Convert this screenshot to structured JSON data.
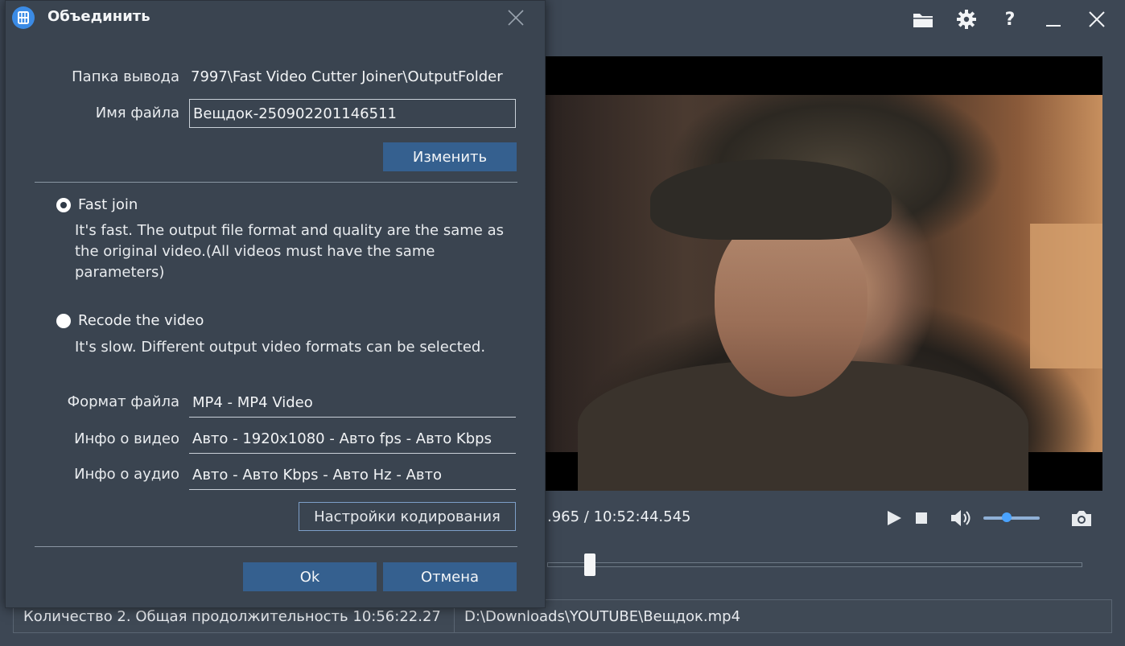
{
  "dialog": {
    "title": "Объединить",
    "output_folder_label": "Папка вывода",
    "output_folder_value": "7997\\Fast Video Cutter Joiner\\OutputFolder",
    "file_name_label": "Имя файла",
    "file_name_value": "Вещдок-250902201146511",
    "change_button": "Изменить",
    "fast_join_label": "Fast join",
    "fast_join_desc": "It's fast. The output file format and quality are the same as the original video.(All videos must have the same parameters)",
    "fast_join_selected": true,
    "recode_label": "Recode the video",
    "recode_desc": "It's slow. Different output video formats can be selected.",
    "recode_selected": false,
    "file_format_label": "Формат файла",
    "file_format_value": "MP4 - MP4 Video",
    "video_info_label": "Инфо о видео",
    "video_info_value": "Авто - 1920x1080 - Авто fps - Авто Kbps",
    "audio_info_label": "Инфо о аудио",
    "audio_info_value": "Авто - Авто Kbps - Авто Hz - Авто",
    "encoding_settings_button": "Настройки кодирования",
    "ok_button": "Ok",
    "cancel_button": "Отмена"
  },
  "player": {
    "time_readout": ".965 / 10:52:44.545",
    "volume_level": 0.4,
    "seek_position": 0.08
  },
  "status_bar": {
    "summary": "Количество 2. Общая продолжительность 10:56:22.27",
    "file_path": "D:\\Downloads\\YOUTUBE\\Вещдок.mp4"
  },
  "colors": {
    "background": "#3d4754",
    "dialog_bg": "#3a4450",
    "button_primary": "#35608f",
    "accent": "#3b8be5"
  },
  "icons": {
    "top_bar": [
      "folder-icon",
      "gear-icon",
      "help-icon",
      "minimize-icon",
      "close-icon"
    ],
    "player": [
      "play-icon",
      "stop-icon",
      "volume-icon",
      "camera-icon"
    ]
  }
}
